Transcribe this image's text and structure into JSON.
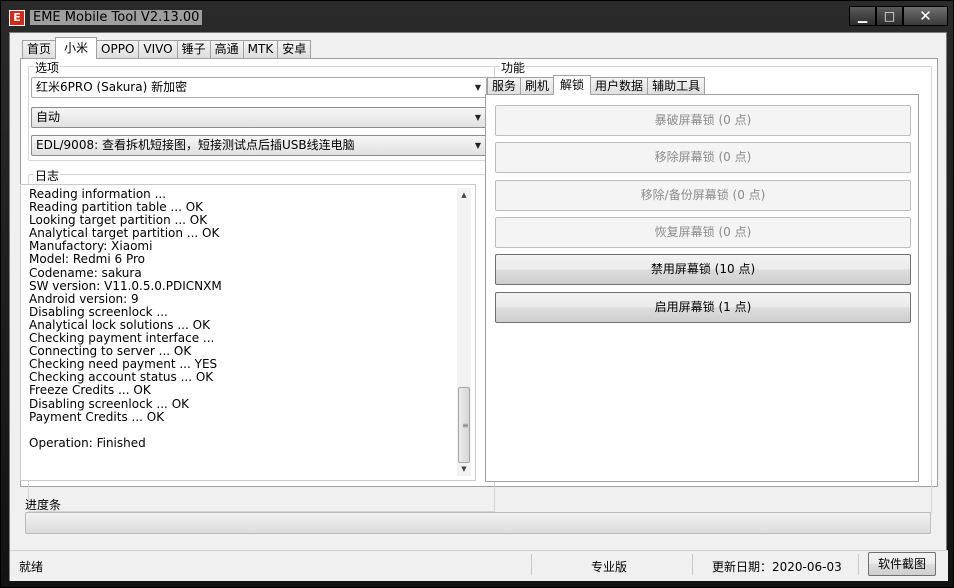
{
  "window": {
    "title": "EME Mobile Tool V2.13.00",
    "icon_glyph": "E",
    "minimize_glyph": "▁",
    "maximize_glyph": "□",
    "close_glyph": "✕"
  },
  "main_tabs": [
    "首页",
    "小米",
    "OPPO",
    "VIVO",
    "锤子",
    "高通",
    "MTK",
    "安卓"
  ],
  "active_main_tab": "小米",
  "options": {
    "label": "选项",
    "model_select": "红米6PRO (Sakura) 新加密",
    "mode_select": "自动",
    "port_select": "EDL/9008: 查看拆机短接图，短接测试点后插USB线连电脑"
  },
  "log": {
    "label": "日志",
    "lines": [
      "Reading information ...",
      "Reading partition table ... OK",
      "Looking target partition ... OK",
      "Analytical target partition ... OK",
      "Manufactory: Xiaomi",
      "Model: Redmi 6 Pro",
      "Codename: sakura",
      "SW version: V11.0.5.0.PDICNXM",
      "Android version: 9",
      "Disabling screenlock ...",
      "Analytical lock solutions ... OK",
      "Checking payment interface ...",
      "Connecting to server ... OK",
      "Checking need payment ... YES",
      "Checking account status ... OK",
      "Freeze Credits ... OK",
      "Disabling screenlock ... OK",
      "Payment Credits ... OK",
      "",
      "Operation: Finished"
    ]
  },
  "function": {
    "label": "功能",
    "tabs": [
      "服务",
      "刷机",
      "解锁",
      "用户数据",
      "辅助工具"
    ],
    "active_tab": "解锁",
    "buttons": [
      {
        "label": "暴破屏幕锁 (0 点)",
        "enabled": false
      },
      {
        "label": "移除屏幕锁 (0 点)",
        "enabled": false
      },
      {
        "label": "移除/备份屏幕锁 (0 点)",
        "enabled": false
      },
      {
        "label": "恢复屏幕锁 (0 点)",
        "enabled": false
      },
      {
        "label": "禁用屏幕锁 (10 点)",
        "enabled": true
      },
      {
        "label": "启用屏幕锁 (1 点)",
        "enabled": true
      }
    ]
  },
  "progress": {
    "label": "进度条",
    "value": 0
  },
  "status": {
    "state": "就绪",
    "edition": "专业版",
    "update_date": "更新日期：2020-06-03",
    "screenshot_button": "软件截图"
  },
  "colors": {
    "title_icon": "#d52a1a",
    "window_frame": "#1b1b1b"
  }
}
